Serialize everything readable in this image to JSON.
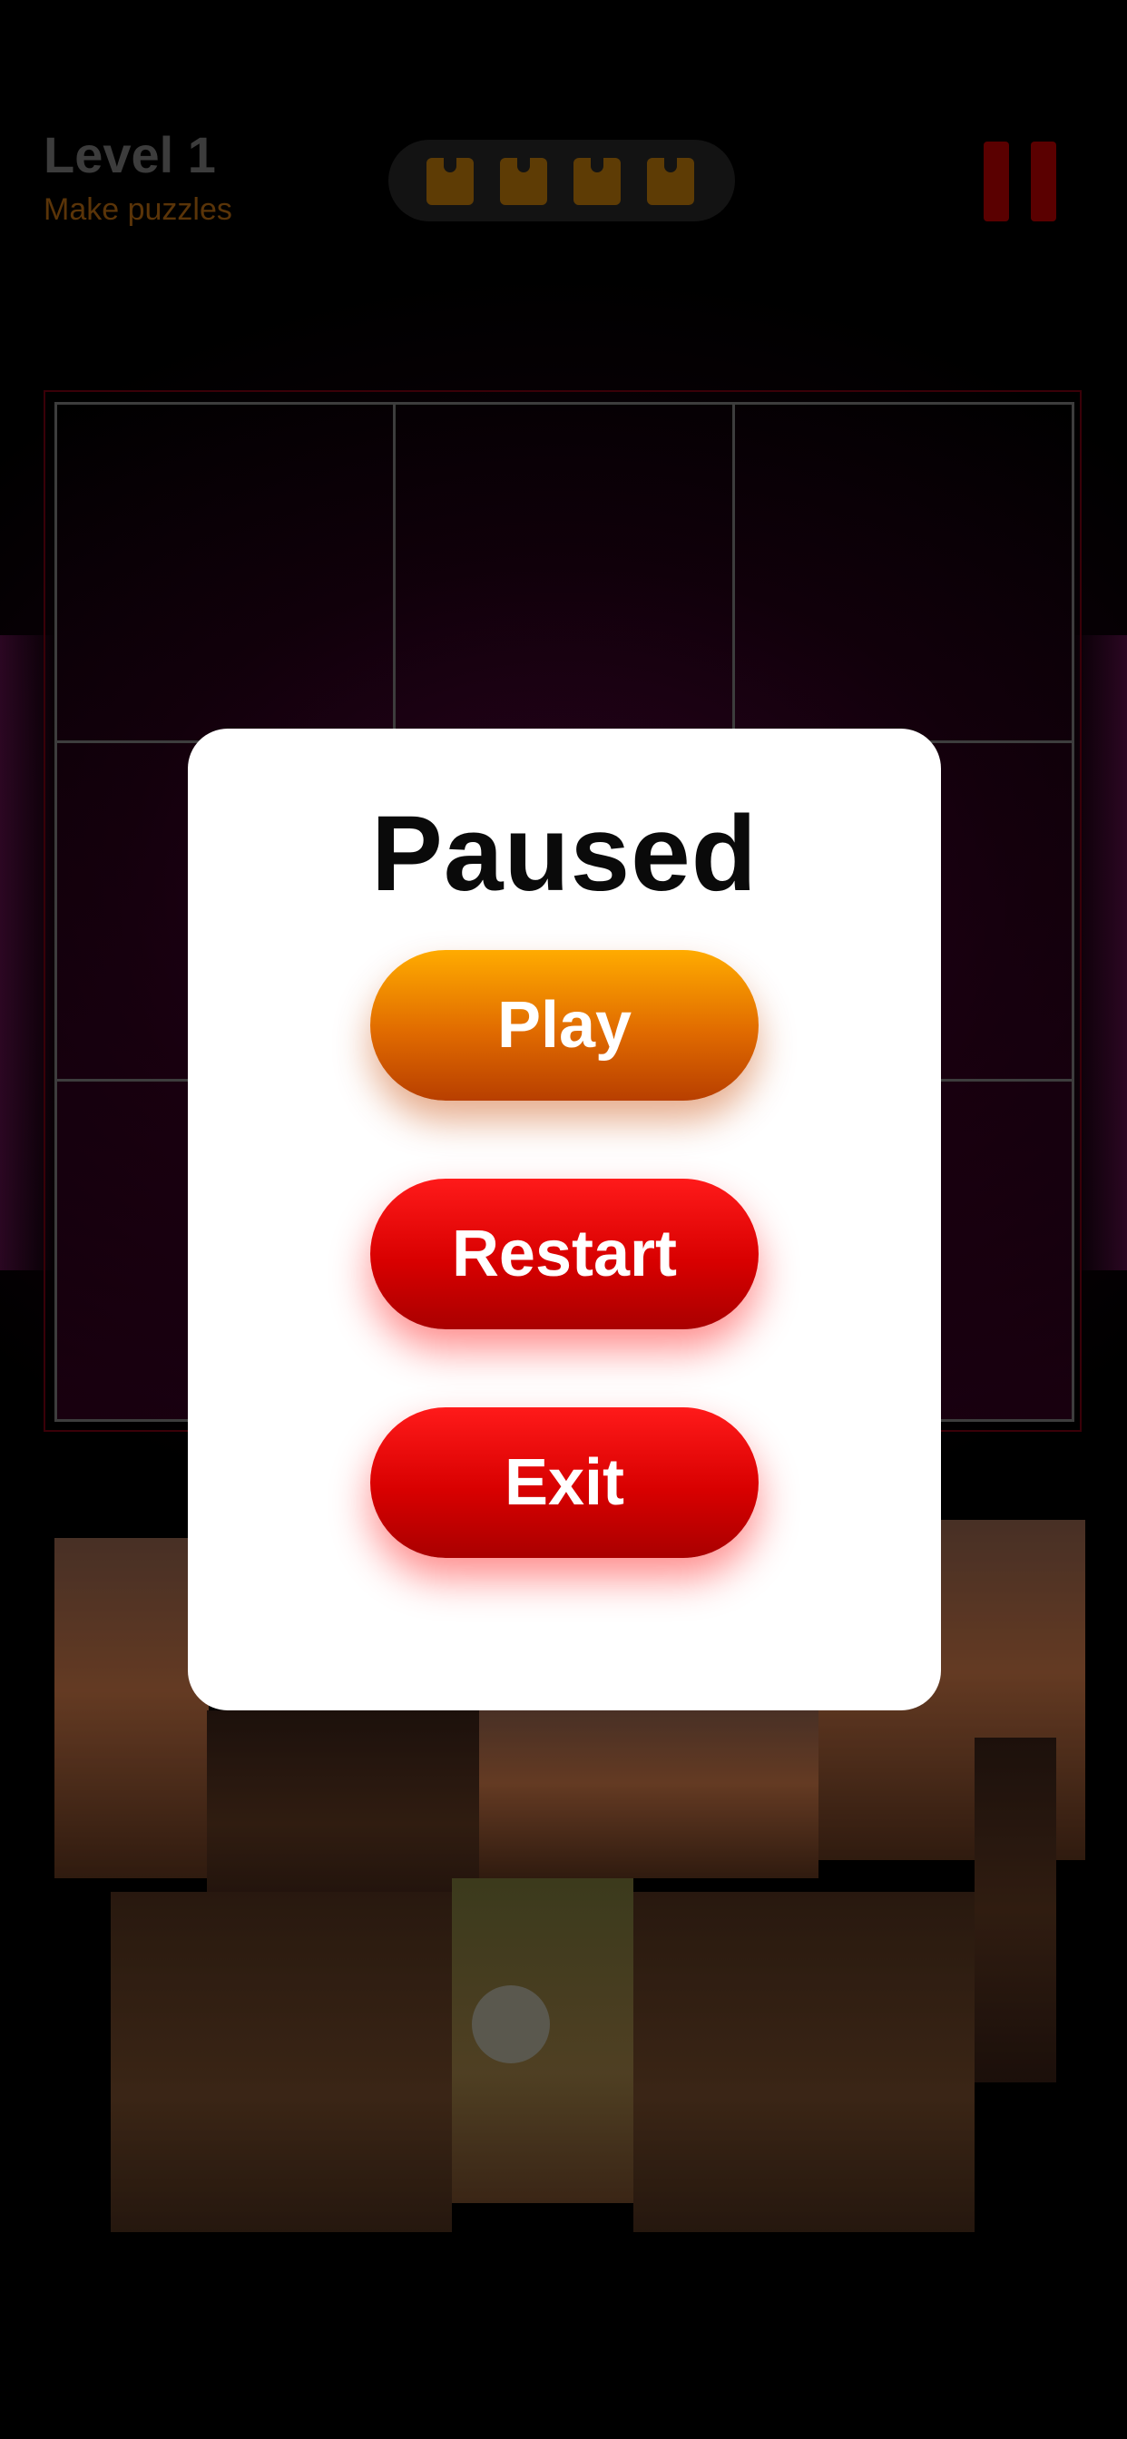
{
  "header": {
    "level_title": "Level 1",
    "level_subtitle": "Make puzzles",
    "pieces_remaining_icons": 4
  },
  "modal": {
    "title": "Paused",
    "buttons": {
      "play": "Play",
      "restart": "Restart",
      "exit": "Exit"
    }
  },
  "colors": {
    "play_button": "#f08a00",
    "restart_button": "#e00000",
    "exit_button": "#e00000",
    "modal_background": "#ffffff",
    "page_background": "#000000"
  },
  "icons": [
    "puzzle-piece-icon",
    "pause-icon"
  ]
}
